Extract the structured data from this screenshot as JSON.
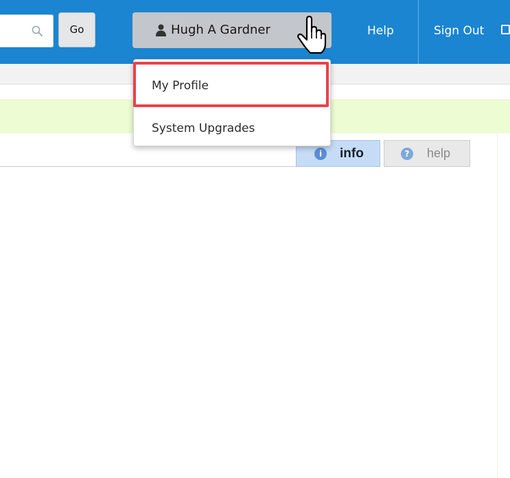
{
  "header": {
    "search": {
      "placeholder": ""
    },
    "go_label": "Go",
    "user_name": "Hugh A Gardner",
    "help_label": "Help",
    "signout_label": "Sign Out"
  },
  "user_menu": {
    "items": [
      {
        "label": "My Profile",
        "highlighted": true
      },
      {
        "label": "System Upgrades",
        "highlighted": false
      }
    ]
  },
  "tabs": [
    {
      "label": "info",
      "active": true
    },
    {
      "label": "help",
      "active": false
    }
  ],
  "colors": {
    "topbar": "#1b85d1",
    "notice_bar": "#eefcd3",
    "highlight_box": "#e8424b",
    "active_tab": "#c6dcf6"
  },
  "icons": [
    "search-icon",
    "user-icon",
    "signout-icon",
    "info-icon",
    "help-icon",
    "pointer-cursor-icon"
  ]
}
